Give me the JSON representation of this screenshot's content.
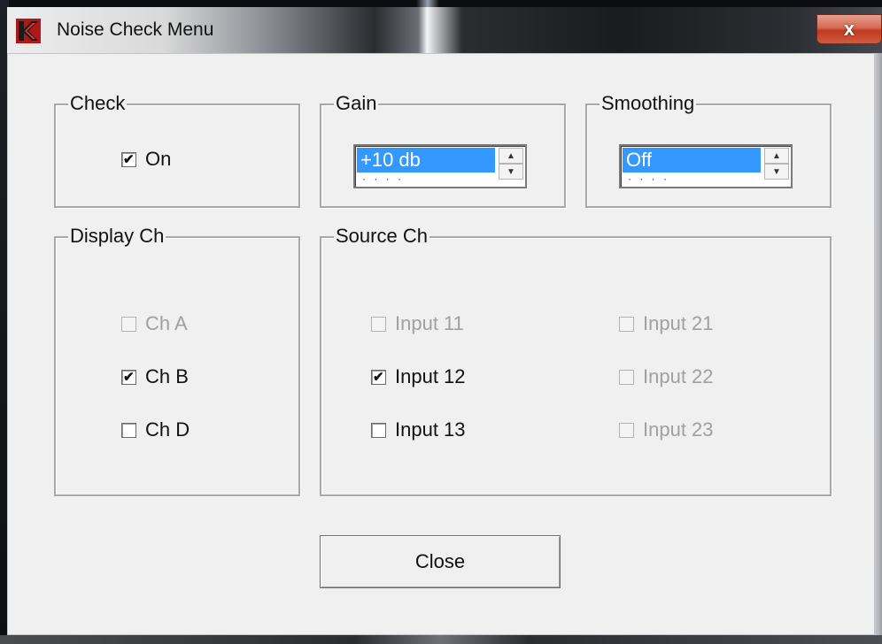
{
  "window": {
    "title": "Noise Check Menu",
    "close_glyph": "x"
  },
  "check_group": {
    "label": "Check",
    "option": {
      "label": "On",
      "checked": true
    }
  },
  "gain_group": {
    "label": "Gain",
    "selected": "+10 db",
    "next_partial": "· · · ·"
  },
  "smoothing_group": {
    "label": "Smoothing",
    "selected": "Off",
    "next_partial": "· · · ·"
  },
  "display_group": {
    "label": "Display Ch",
    "options": [
      {
        "label": "Ch A",
        "checked": false,
        "enabled": false
      },
      {
        "label": "Ch B",
        "checked": true,
        "enabled": true
      },
      {
        "label": "Ch D",
        "checked": false,
        "enabled": true
      }
    ]
  },
  "source_group": {
    "label": "Source Ch",
    "options": [
      {
        "label": "Input 11",
        "checked": false,
        "enabled": false
      },
      {
        "label": "Input 12",
        "checked": true,
        "enabled": true
      },
      {
        "label": "Input 13",
        "checked": false,
        "enabled": true
      },
      {
        "label": "Input 21",
        "checked": false,
        "enabled": false
      },
      {
        "label": "Input 22",
        "checked": false,
        "enabled": false
      },
      {
        "label": "Input 23",
        "checked": false,
        "enabled": false
      }
    ]
  },
  "close_button": {
    "label": "Close"
  },
  "check_glyph": "✔",
  "spin_up_glyph": "▲",
  "spin_down_glyph": "▼",
  "colors": {
    "selection": "#3399ff",
    "close_red": "#c0391f",
    "dialog_bg": "#f0f0f0"
  }
}
